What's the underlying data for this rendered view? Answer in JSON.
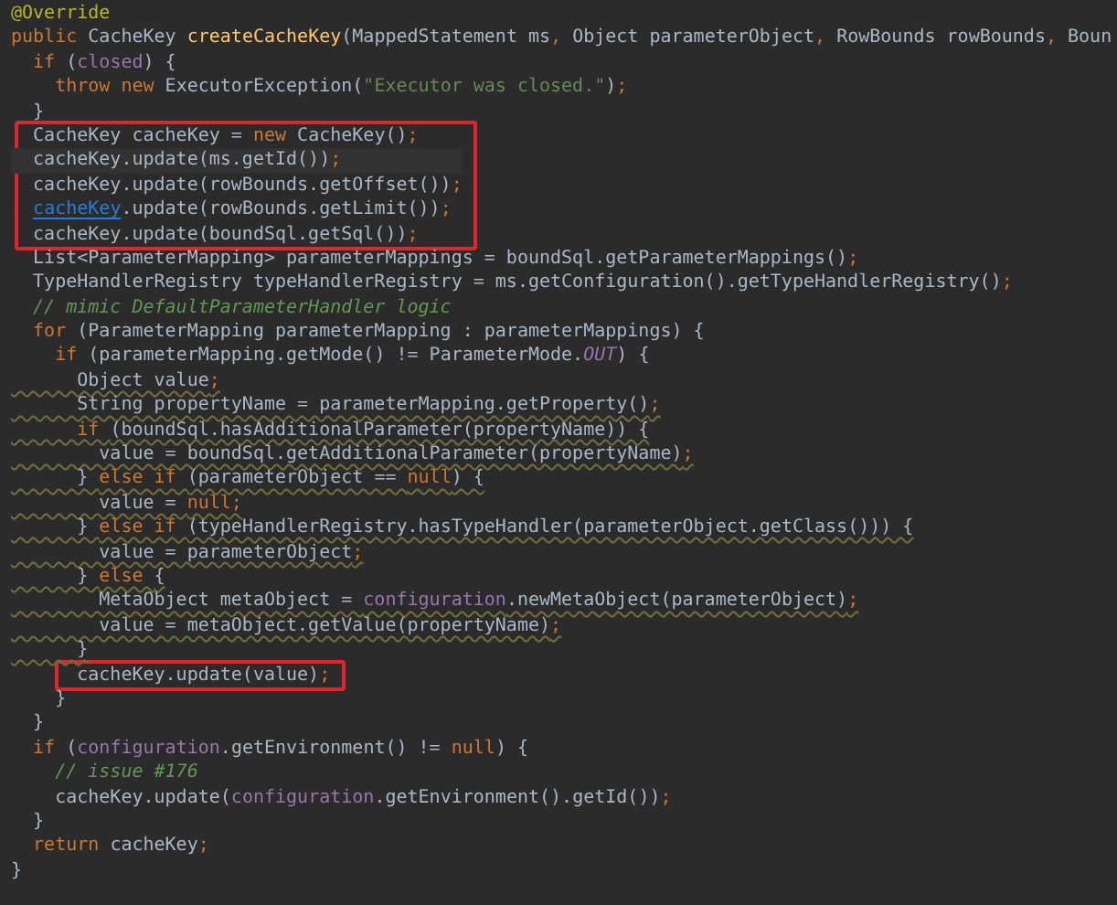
{
  "editor": {
    "lines": [
      {
        "segments": [
          {
            "kind": "annotation",
            "text": "@Override"
          }
        ]
      },
      {
        "segments": [
          {
            "kind": "keyword",
            "text": "public "
          },
          {
            "kind": "plain",
            "text": "CacheKey "
          },
          {
            "kind": "method",
            "text": "createCacheKey"
          },
          {
            "kind": "plain",
            "text": "(MappedStatement ms"
          },
          {
            "kind": "keyword",
            "text": ", "
          },
          {
            "kind": "plain",
            "text": "Object parameterObject"
          },
          {
            "kind": "keyword",
            "text": ", "
          },
          {
            "kind": "plain",
            "text": "RowBounds rowBounds"
          },
          {
            "kind": "keyword",
            "text": ", "
          },
          {
            "kind": "plain",
            "text": "Boun"
          }
        ]
      },
      {
        "segments": [
          {
            "kind": "keyword",
            "text": "  if "
          },
          {
            "kind": "plain",
            "text": "("
          },
          {
            "kind": "field",
            "text": "closed"
          },
          {
            "kind": "plain",
            "text": ") {"
          }
        ]
      },
      {
        "segments": [
          {
            "kind": "keyword",
            "text": "    throw new "
          },
          {
            "kind": "plain",
            "text": "ExecutorException("
          },
          {
            "kind": "string",
            "text": "\"Executor was closed.\""
          },
          {
            "kind": "plain",
            "text": ")"
          },
          {
            "kind": "keyword",
            "text": ";"
          }
        ]
      },
      {
        "segments": [
          {
            "kind": "plain",
            "text": "  }"
          }
        ]
      },
      {
        "boxed": true,
        "segments": [
          {
            "kind": "plain",
            "text": "  CacheKey cacheKey = "
          },
          {
            "kind": "keyword",
            "text": "new "
          },
          {
            "kind": "plain",
            "text": "CacheKey()"
          },
          {
            "kind": "keyword",
            "text": ";"
          }
        ]
      },
      {
        "boxed": true,
        "current": true,
        "segments": [
          {
            "kind": "plain",
            "text": "  cacheKey.update(ms.getId())"
          },
          {
            "kind": "keyword",
            "text": ";"
          }
        ]
      },
      {
        "boxed": true,
        "segments": [
          {
            "kind": "plain",
            "text": "  cacheKey.update(rowBounds.getOffset())"
          },
          {
            "kind": "keyword",
            "text": ";"
          }
        ]
      },
      {
        "boxed": true,
        "segments": [
          {
            "kind": "link",
            "text": "  cacheKey"
          },
          {
            "kind": "plain",
            "text": ".update(rowBounds.getLimit())"
          },
          {
            "kind": "keyword",
            "text": ";"
          }
        ]
      },
      {
        "boxed": true,
        "segments": [
          {
            "kind": "plain",
            "text": "  cacheKey.update(boundSql.getSql())"
          },
          {
            "kind": "keyword",
            "text": ";"
          }
        ]
      },
      {
        "segments": [
          {
            "kind": "plain",
            "text": "  List<ParameterMapping> parameterMappings = boundSql.getParameterMappings()"
          },
          {
            "kind": "keyword",
            "text": ";"
          }
        ]
      },
      {
        "segments": [
          {
            "kind": "plain",
            "text": "  TypeHandlerRegistry typeHandlerRegistry = ms.getConfiguration().getTypeHandlerRegistry()"
          },
          {
            "kind": "keyword",
            "text": ";"
          }
        ]
      },
      {
        "segments": [
          {
            "kind": "comment",
            "text": "  // mimic DefaultParameterHandler logic"
          }
        ]
      },
      {
        "segments": [
          {
            "kind": "keyword",
            "text": "  for "
          },
          {
            "kind": "plain",
            "text": "(ParameterMapping parameterMapping : parameterMappings) {"
          }
        ]
      },
      {
        "segments": [
          {
            "kind": "keyword",
            "text": "    if "
          },
          {
            "kind": "plain",
            "text": "(parameterMapping.getMode() != ParameterMode."
          },
          {
            "kind": "constant",
            "text": "OUT"
          },
          {
            "kind": "plain",
            "text": ") {"
          }
        ]
      },
      {
        "warning": true,
        "segments": [
          {
            "kind": "plain",
            "text": "      Object value"
          },
          {
            "kind": "keyword",
            "text": ";"
          }
        ]
      },
      {
        "warning": true,
        "segments": [
          {
            "kind": "plain",
            "text": "      String propertyName = parameterMapping.getProperty()"
          },
          {
            "kind": "keyword",
            "text": ";"
          }
        ]
      },
      {
        "warning": true,
        "segments": [
          {
            "kind": "keyword",
            "text": "      if "
          },
          {
            "kind": "plain",
            "text": "(boundSql.hasAdditionalParameter(propertyName)) {"
          }
        ]
      },
      {
        "warning": true,
        "segments": [
          {
            "kind": "plain",
            "text": "        value = boundSql.getAdditionalParameter(propertyName)"
          },
          {
            "kind": "keyword",
            "text": ";"
          }
        ]
      },
      {
        "warning": true,
        "segments": [
          {
            "kind": "plain",
            "text": "      } "
          },
          {
            "kind": "keyword",
            "text": "else if "
          },
          {
            "kind": "plain",
            "text": "(parameterObject == "
          },
          {
            "kind": "keyword",
            "text": "null"
          },
          {
            "kind": "plain",
            "text": ") {"
          }
        ]
      },
      {
        "warning": true,
        "segments": [
          {
            "kind": "plain",
            "text": "        value = "
          },
          {
            "kind": "keyword",
            "text": "null;"
          }
        ]
      },
      {
        "warning": true,
        "segments": [
          {
            "kind": "plain",
            "text": "      } "
          },
          {
            "kind": "keyword",
            "text": "else if "
          },
          {
            "kind": "plain",
            "text": "(typeHandlerRegistry.hasTypeHandler(parameterObject.getClass())) {"
          }
        ]
      },
      {
        "warning": true,
        "segments": [
          {
            "kind": "plain",
            "text": "        value = parameterObject"
          },
          {
            "kind": "keyword",
            "text": ";"
          }
        ]
      },
      {
        "warning": true,
        "segments": [
          {
            "kind": "plain",
            "text": "      } "
          },
          {
            "kind": "keyword",
            "text": "else "
          },
          {
            "kind": "plain",
            "text": "{"
          }
        ]
      },
      {
        "warning": true,
        "segments": [
          {
            "kind": "plain",
            "text": "        MetaObject metaObject = "
          },
          {
            "kind": "field",
            "text": "configuration"
          },
          {
            "kind": "plain",
            "text": ".newMetaObject(parameterObject)"
          },
          {
            "kind": "keyword",
            "text": ";"
          }
        ]
      },
      {
        "warning": true,
        "segments": [
          {
            "kind": "plain",
            "text": "        value = metaObject.getValue(propertyName)"
          },
          {
            "kind": "keyword",
            "text": ";"
          }
        ]
      },
      {
        "warning": true,
        "segments": [
          {
            "kind": "plain",
            "text": "      }"
          }
        ]
      },
      {
        "boxed": true,
        "segments": [
          {
            "kind": "plain",
            "text": "      cacheKey.update(value)"
          },
          {
            "kind": "keyword",
            "text": ";"
          }
        ]
      },
      {
        "segments": [
          {
            "kind": "plain",
            "text": "    }"
          }
        ]
      },
      {
        "segments": [
          {
            "kind": "plain",
            "text": "  }"
          }
        ]
      },
      {
        "segments": [
          {
            "kind": "keyword",
            "text": "  if "
          },
          {
            "kind": "plain",
            "text": "("
          },
          {
            "kind": "field",
            "text": "configuration"
          },
          {
            "kind": "plain",
            "text": ".getEnvironment() != "
          },
          {
            "kind": "keyword",
            "text": "null"
          },
          {
            "kind": "plain",
            "text": ") {"
          }
        ]
      },
      {
        "segments": [
          {
            "kind": "comment",
            "text": "    // issue #176"
          }
        ]
      },
      {
        "segments": [
          {
            "kind": "plain",
            "text": "    cacheKey.update("
          },
          {
            "kind": "field",
            "text": "configuration"
          },
          {
            "kind": "plain",
            "text": ".getEnvironment().getId())"
          },
          {
            "kind": "keyword",
            "text": ";"
          }
        ]
      },
      {
        "segments": [
          {
            "kind": "plain",
            "text": "  }"
          }
        ]
      },
      {
        "segments": [
          {
            "kind": "keyword",
            "text": "  return "
          },
          {
            "kind": "plain",
            "text": "cacheKey"
          },
          {
            "kind": "keyword",
            "text": ";"
          }
        ]
      },
      {
        "segments": [
          {
            "kind": "plain",
            "text": "}"
          }
        ]
      }
    ]
  }
}
